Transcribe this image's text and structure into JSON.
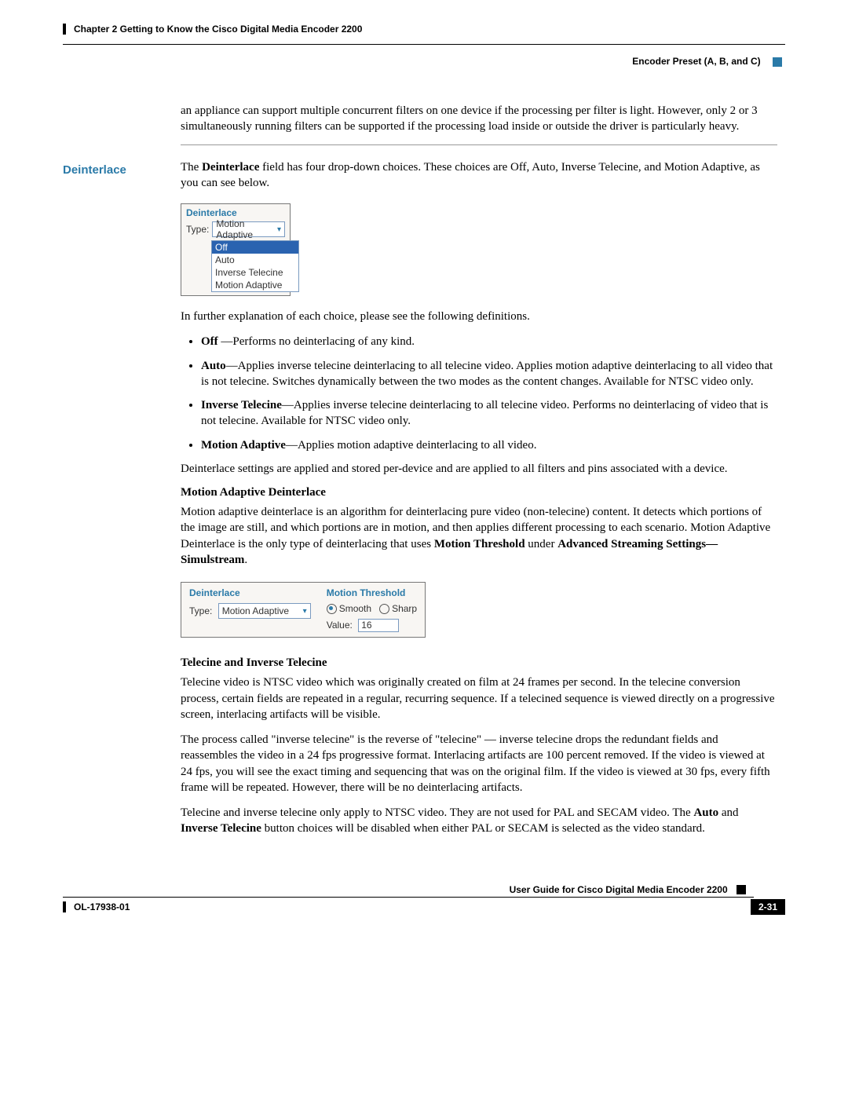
{
  "header": {
    "chapter_line": "Chapter 2    Getting to Know the Cisco Digital Media Encoder 2200",
    "section_right": "Encoder Preset (A, B, and C)"
  },
  "intro_para": "an appliance can support multiple concurrent filters on one device if the processing per filter is light. However, only 2 or 3 simultaneously running filters can be supported if the processing load inside or outside the driver is particularly heavy.",
  "side_heading": "Deinterlace",
  "deint_intro_prefix": "The ",
  "deint_intro_bold": "Deinterlace",
  "deint_intro_rest": " field has four drop-down choices. These choices are Off, Auto, Inverse Telecine, and Motion Adaptive, as you can see below.",
  "ui1": {
    "title": "Deinterlace",
    "type_label": "Type:",
    "selected": "Motion Adaptive",
    "options": [
      "Off",
      "Auto",
      "Inverse Telecine",
      "Motion Adaptive"
    ]
  },
  "after_ui1": "In further explanation of each choice, please see the following definitions.",
  "bullets": {
    "b1_bold": "Off",
    "b1_rest": " —Performs no deinterlacing of any kind.",
    "b2_bold": "Auto",
    "b2_rest": "—Applies inverse telecine deinterlacing to all telecine video. Applies motion adaptive deinterlacing to all video that is not telecine. Switches dynamically between the two modes as the content changes. Available for NTSC video only.",
    "b3_bold": "Inverse Telecine",
    "b3_rest": "—Applies inverse telecine deinterlacing to all telecine video. Performs no deinterlacing of video that is not telecine. Available for NTSC video only.",
    "b4_bold": "Motion Adaptive",
    "b4_rest": "—Applies motion adaptive deinterlacing to all video."
  },
  "after_bullets": "Deinterlace settings are applied and stored per-device and are applied to all filters and pins associated with a device.",
  "sub1": "Motion Adaptive Deinterlace",
  "mad_para_prefix": "Motion adaptive deinterlace is an algorithm for deinterlacing pure video (non-telecine) content. It detects which portions of the image are still, and which portions are in motion, and then applies different processing to each scenario. Motion Adaptive Deinterlace is the only type of deinterlacing that uses ",
  "mad_bold1": "Motion Threshold",
  "mad_mid": " under ",
  "mad_bold2": "Advanced Streaming Settings—Simulstream",
  "mad_end": ".",
  "ui2": {
    "left_title": "Deinterlace",
    "type_label": "Type:",
    "selected": "Motion Adaptive",
    "right_title": "Motion Threshold",
    "smooth": "Smooth",
    "sharp": "Sharp",
    "value_label": "Value:",
    "value": "16"
  },
  "sub2": "Telecine and Inverse Telecine",
  "tel_p1": "Telecine video is NTSC video which was originally created on film at 24 frames per second. In the telecine conversion process, certain fields are repeated in a regular, recurring sequence. If a telecined sequence is viewed directly on a progressive screen, interlacing artifacts will be visible.",
  "tel_p2": "The process called \"inverse telecine\" is the reverse of \"telecine\" — inverse telecine drops the redundant fields and reassembles the video in a 24 fps progressive format. Interlacing artifacts are 100 percent removed. If the video is viewed at 24 fps, you will see the exact timing and sequencing that was on the original film. If the video is viewed at 30 fps, every fifth frame will be repeated. However, there will be no deinterlacing artifacts.",
  "tel_p3_prefix": "Telecine and inverse telecine only apply to NTSC video. They are not used for PAL and SECAM video. The ",
  "tel_p3_b1": "Auto",
  "tel_p3_mid": " and ",
  "tel_p3_b2": "Inverse Telecine",
  "tel_p3_rest": " button choices will be disabled when either PAL or SECAM is selected as the video standard.",
  "footer": {
    "guide_title": "User Guide for Cisco Digital Media Encoder 2200",
    "doc_id": "OL-17938-01",
    "page_num": "2-31"
  }
}
